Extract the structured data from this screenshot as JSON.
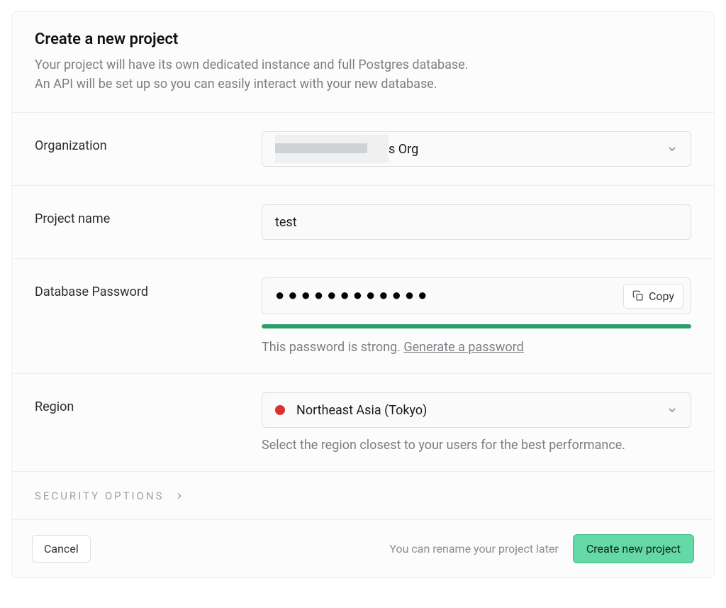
{
  "header": {
    "title": "Create a new project",
    "subtitle_line1": "Your project will have its own dedicated instance and full Postgres database.",
    "subtitle_line2": "An API will be set up so you can easily interact with your new database."
  },
  "organization": {
    "label": "Organization",
    "value_suffix": "s Org"
  },
  "project_name": {
    "label": "Project name",
    "value": "test"
  },
  "password": {
    "label": "Database Password",
    "value_mask": "●●●●●●●●●●●●",
    "copy_label": "Copy",
    "strength_text": "This password is strong.",
    "generate_link": "Generate a password",
    "strength_color": "#2e9e6b"
  },
  "region": {
    "label": "Region",
    "selected": "Northeast Asia (Tokyo)",
    "hint": "Select the region closest to your users for the best performance.",
    "flag_color": "#de2f2f"
  },
  "security": {
    "label": "SECURITY OPTIONS"
  },
  "footer": {
    "cancel": "Cancel",
    "hint": "You can rename your project later",
    "submit": "Create new project"
  }
}
